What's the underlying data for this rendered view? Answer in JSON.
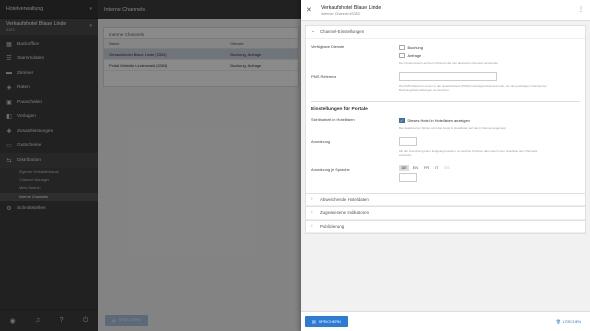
{
  "nav": {
    "top_title": "Hotelverwaltung",
    "hotel_name": "Verkaufshotel Blaue Linde",
    "hotel_id": "3353",
    "items": [
      {
        "label": "Backoffice",
        "icon": "building-icon"
      },
      {
        "label": "Stammdaten",
        "icon": "list-icon"
      },
      {
        "label": "Zimmer",
        "icon": "bed-icon"
      },
      {
        "label": "Raten",
        "icon": "tag-icon"
      },
      {
        "label": "Pauschalen",
        "icon": "package-icon"
      },
      {
        "label": "Vorlagen",
        "icon": "template-icon"
      },
      {
        "label": "Zusatzleistungen",
        "icon": "extras-icon"
      },
      {
        "label": "Gutscheine",
        "icon": "voucher-icon"
      },
      {
        "label": "Distribution",
        "icon": "distribution-icon"
      }
    ],
    "subitems": [
      "Eigener Verkäuferkanal",
      "Channel Manager",
      "Meta Search",
      "Interne Channels"
    ],
    "bottom_item": "Schnittstellen"
  },
  "list_panel": {
    "header": "Interne Channels",
    "card_title": "Interne Channels",
    "columns": [
      "Name",
      "Dienste"
    ],
    "rows": [
      {
        "name": "Verkaufshotel Blaue Linde (3353)",
        "services": "Buchung, Anfrage"
      },
      {
        "name": "Portal Website Lindenwald (3363)",
        "services": "Buchung, Anfrage"
      }
    ],
    "save_label": "SPEICHERN"
  },
  "drawer": {
    "title": "Verkaufshotel Blaue Linde",
    "subtitle": "Interner Channel #3353",
    "section1_title": "Channel-Einstellungen",
    "services_label": "Verfügbare Dienste",
    "service_options": [
      "Buchung",
      "Anfrage"
    ],
    "services_hint": "Den Systemusers auf dem Channel die hier aktivierten Dienste verwenden.",
    "pms_label": "PMS Referenz",
    "pms_value": "",
    "pms_hint": "Die PMS Referenz ist der in der Hotelsoftware (PMS) hinterlegte Referenzcode, um den jeweiligen Channel bei Buchungsübermittlungen zuzuordnen.",
    "portals_title": "Einstellungen für Portale",
    "visibility_label": "Sichtbarkeit in Hotellisten",
    "visibility_option": "Dieses Hotel in Hotellisten anzeigen",
    "visibility_hint": "Bei deaktivierter Option wird das Hotel in Hotellisten auf dem Channel angezeigt.",
    "order_label": "Anordnung",
    "order_hint": "Mit der Anordnung kann festgelegt werden, an welcher Position das Hotel in der Hotelliste des Channels erscheint.",
    "order_lang_label": "Anordnung je Sprache",
    "languages": [
      "DE",
      "EN",
      "FR",
      "IT",
      "ES"
    ],
    "collapsed_sections": [
      "Abweichende Hoteldaten",
      "Zugewiesene Indikatoren",
      "Publizierung"
    ],
    "save_label": "SPEICHERN",
    "delete_label": "LÖSCHEN"
  }
}
